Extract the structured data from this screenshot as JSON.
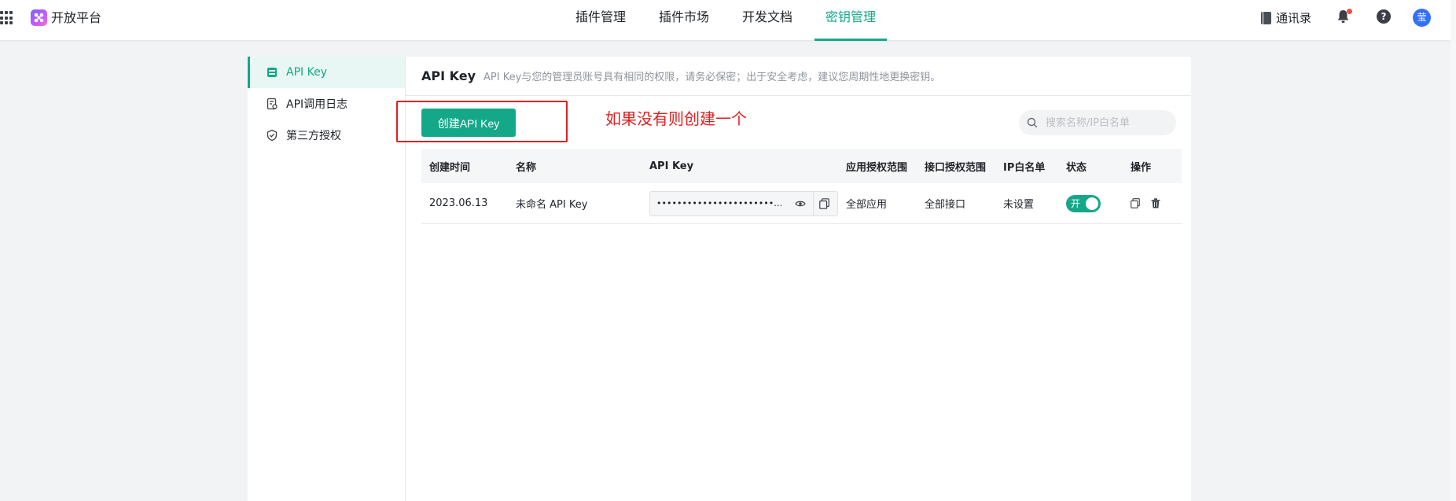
{
  "header": {
    "brand": "开放平台",
    "nav": [
      "插件管理",
      "插件市场",
      "开发文档",
      "密钥管理"
    ],
    "active_nav": "密钥管理",
    "contacts": "通讯录",
    "help": "?",
    "avatar": "莹"
  },
  "sidebar": {
    "items": [
      {
        "label": "API Key",
        "icon": "key-card-icon",
        "active": true
      },
      {
        "label": "API调用日志",
        "icon": "log-icon",
        "active": false
      },
      {
        "label": "第三方授权",
        "icon": "shield-check-icon",
        "active": false
      }
    ]
  },
  "main": {
    "title": "API Key",
    "description": "API Key与您的管理员账号具有相同的权限，请务必保密；出于安全考虑，建议您周期性地更换密钥。",
    "create_button": "创建API Key",
    "annotation": "如果没有则创建一个",
    "search_placeholder": "搜索名称/IP白名单"
  },
  "table": {
    "columns": [
      "创建时间",
      "名称",
      "API Key",
      "应用授权范围",
      "接口授权范围",
      "IP白名单",
      "状态",
      "操作"
    ],
    "rows": [
      {
        "created": "2023.06.13",
        "name": "未命名 API Key",
        "key_masked": "••••••••••••••••••••••••••••••••••••••••...",
        "app_scope": "全部应用",
        "api_scope": "全部接口",
        "ip_whitelist": "未设置",
        "status_label": "开",
        "status_on": true
      }
    ]
  },
  "colors": {
    "accent": "#14a889",
    "annotation": "#e02020",
    "notification_dot": "#f54a45",
    "avatar": "#3370ff"
  }
}
